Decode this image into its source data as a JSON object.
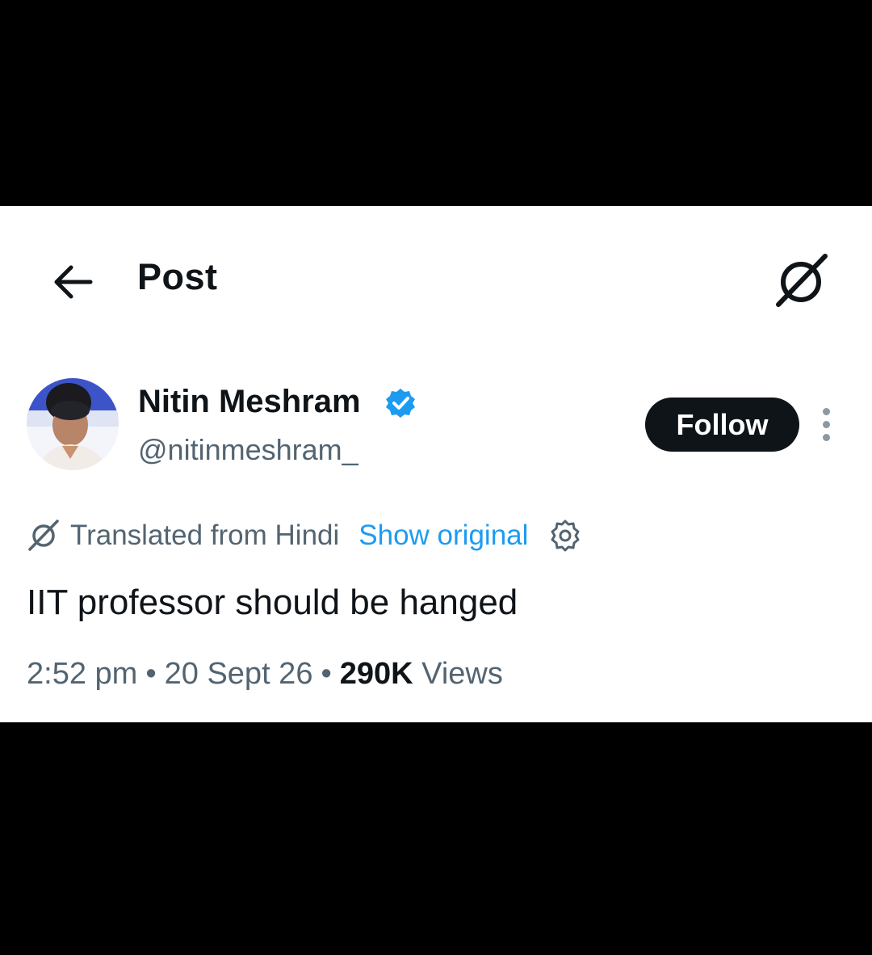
{
  "header": {
    "back_icon": "arrow-left-icon",
    "title": "Post",
    "grok_icon": "grok-icon"
  },
  "author": {
    "display_name": "Nitin Meshram",
    "verified": true,
    "verified_color": "#1d9bf0",
    "handle": "@nitinmeshram_",
    "follow_label": "Follow",
    "more_icon": "more-vertical-icon"
  },
  "translation": {
    "icon": "grok-icon",
    "text": "Translated from Hindi",
    "show_original_label": "Show original",
    "settings_icon": "gear-icon"
  },
  "post": {
    "text": "IIT professor should be hanged",
    "time": "2:52 pm",
    "date": "20 Sept 26",
    "views_count": "290K",
    "views_label": "Views"
  },
  "colors": {
    "text_primary": "#0f1419",
    "text_secondary": "#536471",
    "link": "#1d9bf0",
    "follow_bg": "#0f1419",
    "follow_text": "#ffffff",
    "letterbox": "#000000"
  }
}
